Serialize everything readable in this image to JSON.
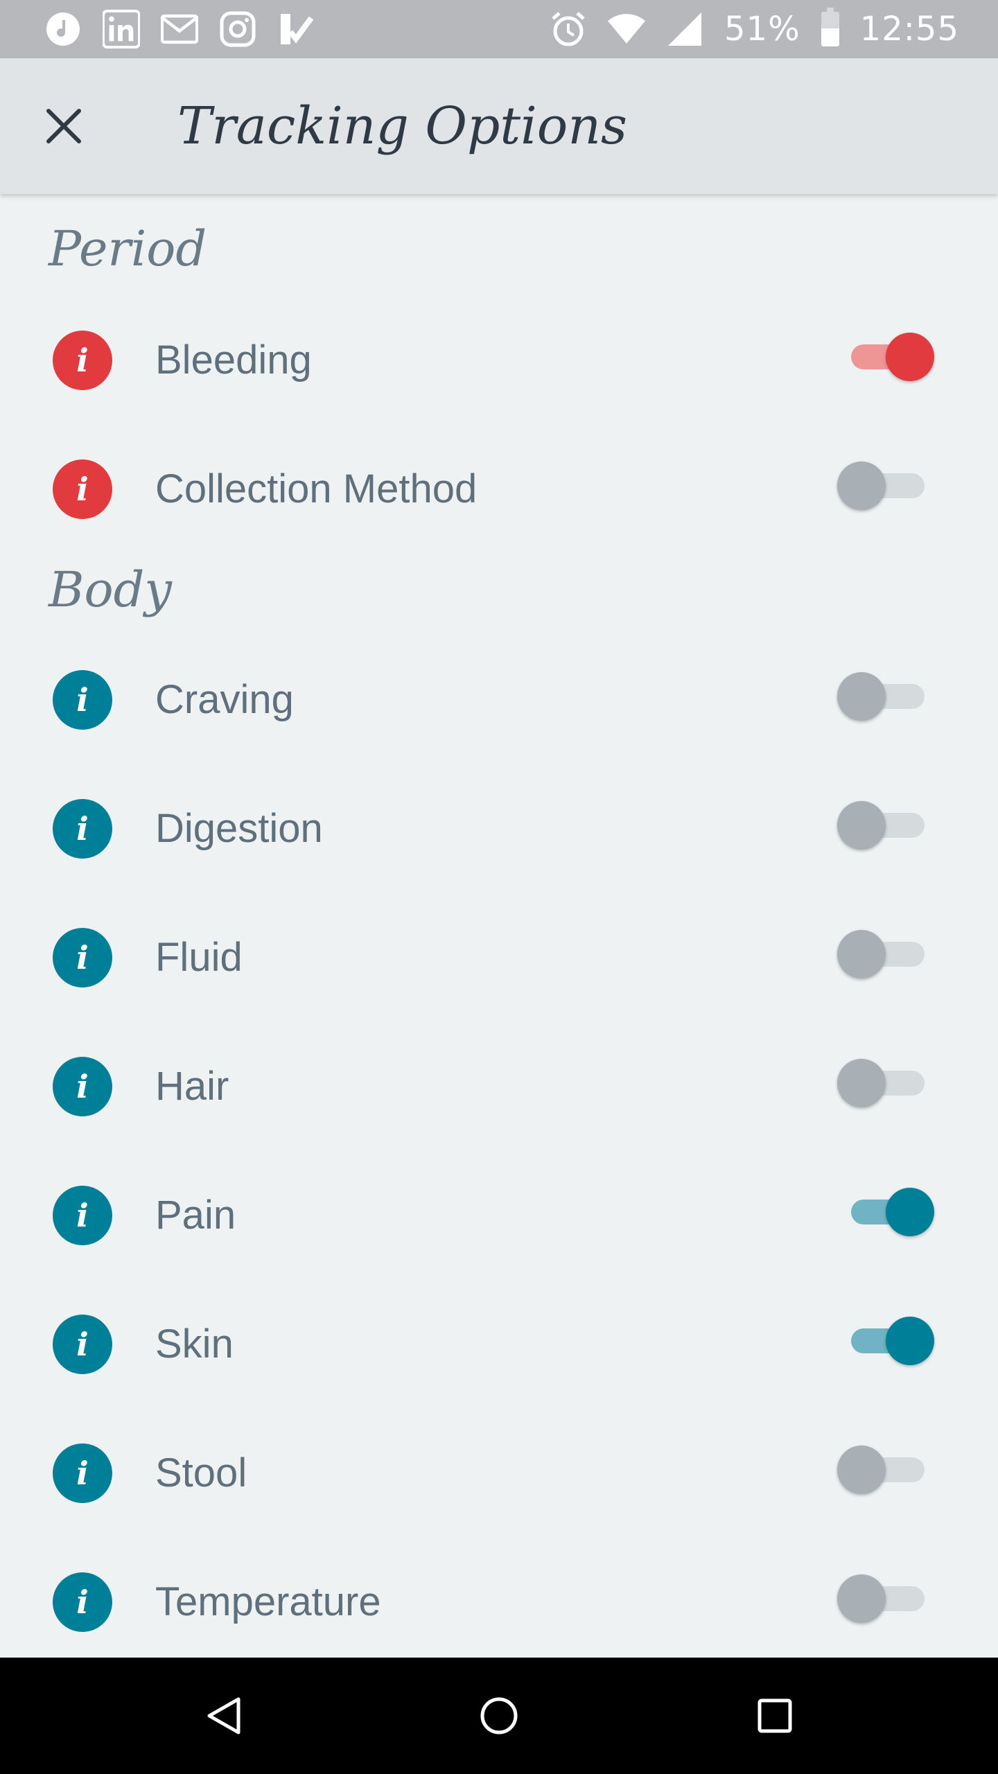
{
  "status_bar": {
    "left_icons": [
      "music-note-icon",
      "linkedin-icon",
      "gmail-icon",
      "instagram-icon",
      "tasks-check-icon"
    ],
    "battery_percent": "51%",
    "battery_level": 0.51,
    "time": "12:55"
  },
  "app_bar": {
    "title": "Tracking Options"
  },
  "sections": [
    {
      "title": "Period",
      "accent": "#e23b3f",
      "items": [
        {
          "label": "Bleeding",
          "enabled": true
        },
        {
          "label": "Collection Method",
          "enabled": false
        }
      ]
    },
    {
      "title": "Body",
      "accent": "#007f98",
      "items": [
        {
          "label": "Craving",
          "enabled": false
        },
        {
          "label": "Digestion",
          "enabled": false
        },
        {
          "label": "Fluid",
          "enabled": false
        },
        {
          "label": "Hair",
          "enabled": false
        },
        {
          "label": "Pain",
          "enabled": true
        },
        {
          "label": "Skin",
          "enabled": true
        },
        {
          "label": "Stool",
          "enabled": false
        },
        {
          "label": "Temperature",
          "enabled": false
        }
      ]
    }
  ],
  "info_glyph": "i",
  "nav_bar": {
    "buttons": [
      "back-icon",
      "home-icon",
      "recents-icon"
    ]
  }
}
